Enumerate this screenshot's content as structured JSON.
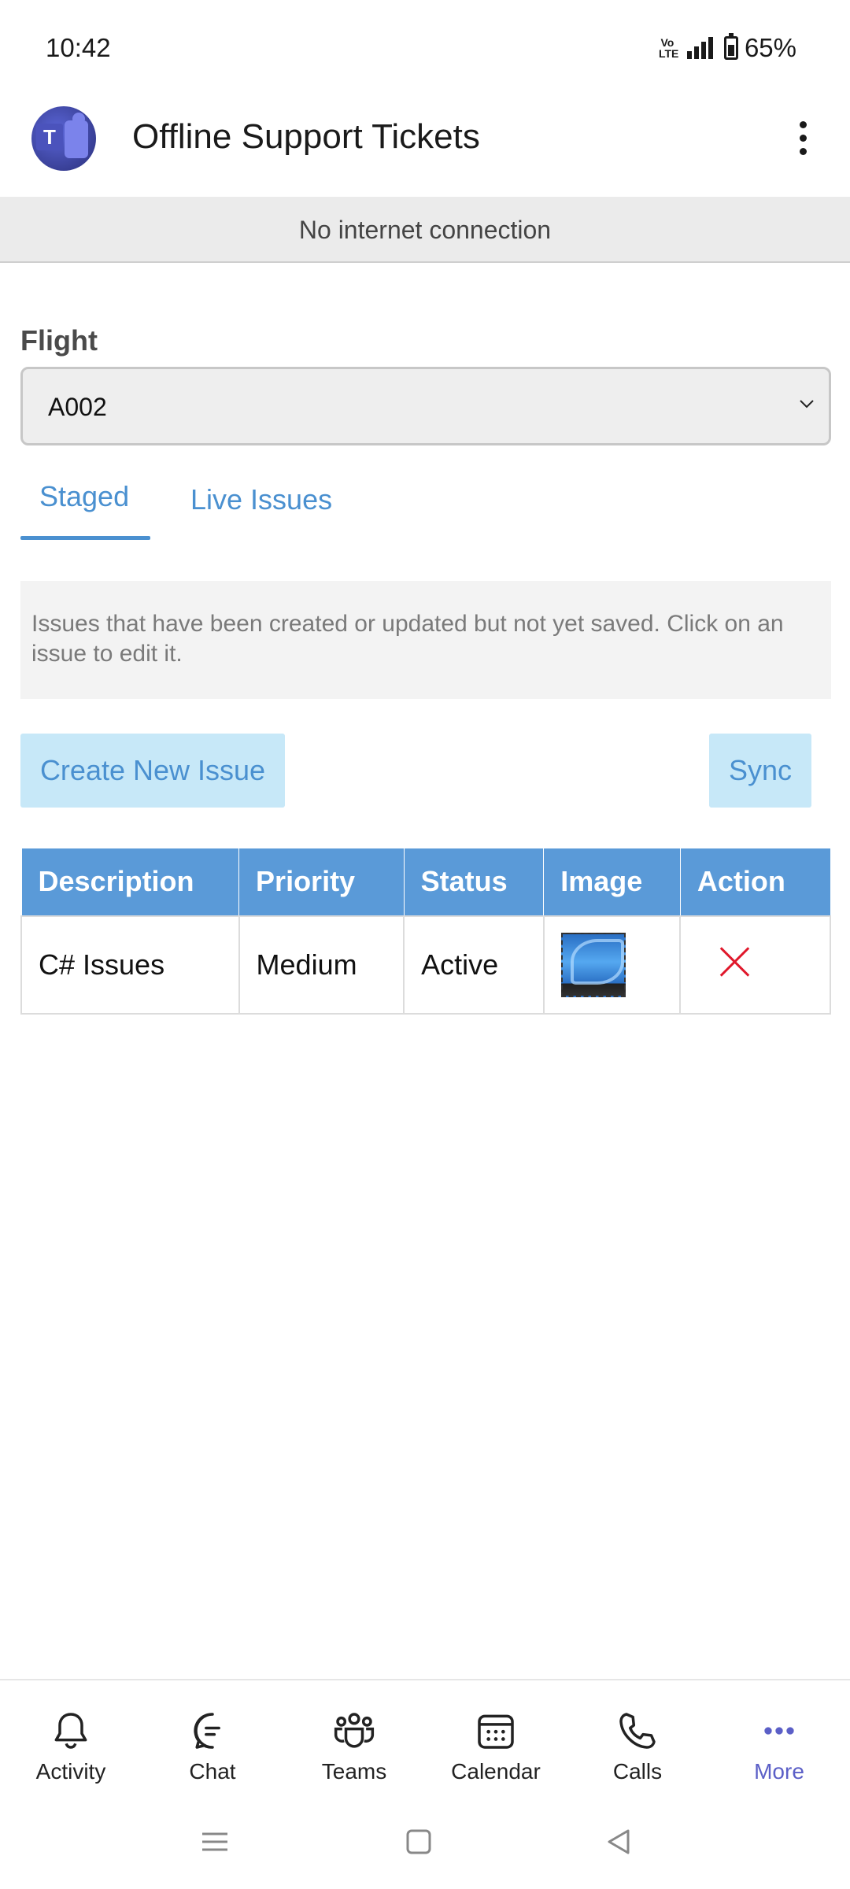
{
  "status_bar": {
    "time": "10:42",
    "volte": "Vo LTE",
    "battery_text": "65%",
    "battery_level": 0.65
  },
  "header": {
    "title": "Offline Support Tickets",
    "avatar_icon": "teams-logo-icon",
    "more_icon": "more-vertical-icon"
  },
  "banner": {
    "text": "No internet connection"
  },
  "flight": {
    "label": "Flight",
    "selected": "A002"
  },
  "tabs": [
    {
      "label": "Staged",
      "active": true
    },
    {
      "label": "Live Issues",
      "active": false
    }
  ],
  "info": {
    "text": "Issues that have been created or updated but not yet saved. Click on an issue to edit it."
  },
  "buttons": {
    "create": "Create New Issue",
    "sync": "Sync"
  },
  "table": {
    "headers": [
      "Description",
      "Priority",
      "Status",
      "Image",
      "Action"
    ],
    "rows": [
      {
        "description": "C# Issues",
        "priority": "Medium",
        "status": "Active"
      }
    ]
  },
  "bottom_nav": [
    {
      "label": "Activity",
      "icon": "bell-icon"
    },
    {
      "label": "Chat",
      "icon": "chat-icon"
    },
    {
      "label": "Teams",
      "icon": "teams-icon"
    },
    {
      "label": "Calendar",
      "icon": "calendar-icon"
    },
    {
      "label": "Calls",
      "icon": "phone-icon"
    },
    {
      "label": "More",
      "icon": "more-horizontal-icon",
      "active": true
    }
  ],
  "colors": {
    "accent": "#4a90d0",
    "table_header": "#5a9ad8",
    "button_bg": "#c7e8f8",
    "delete": "#e0182b",
    "nav_active": "#5b5fc7"
  }
}
